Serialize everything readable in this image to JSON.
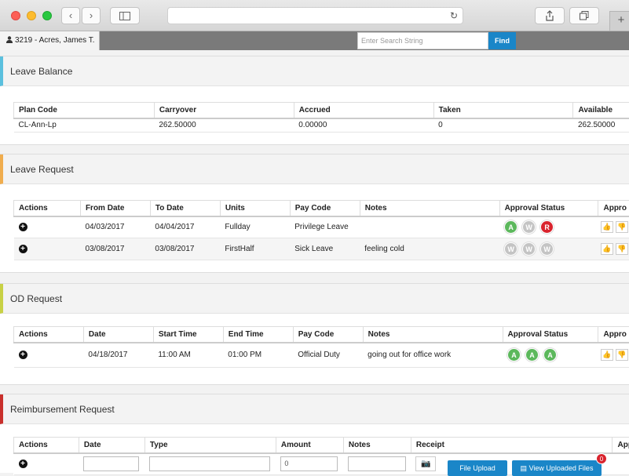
{
  "header": {
    "user_label": "3219 - Acres, James T.",
    "search_placeholder": "Enter Search String",
    "find_label": "Find"
  },
  "colors": {
    "leave_balance": "#5bc0de",
    "leave_request": "#f0ad4e",
    "od_request": "#c8d145",
    "reimbursement": "#c9302c",
    "approved": "#5cb85c",
    "rejected": "#d9232d",
    "pending": "#c4c4c4",
    "primary": "#1a86c8"
  },
  "leave_balance": {
    "title": "Leave Balance",
    "columns": [
      "Plan Code",
      "Carryover",
      "Accrued",
      "Taken",
      "Available"
    ],
    "rows": [
      [
        "CL-Ann-Lp",
        "262.50000",
        "0.00000",
        "0",
        "262.50000"
      ]
    ]
  },
  "leave_request": {
    "title": "Leave Request",
    "columns": [
      "Actions",
      "From Date",
      "To Date",
      "Units",
      "Pay Code",
      "Notes",
      "Approval Status",
      "Appro"
    ],
    "rows": [
      {
        "from": "04/03/2017",
        "to": "04/04/2017",
        "units": "Fullday",
        "pay_code": "Privilege Leave",
        "notes": "",
        "status": [
          "A",
          "W",
          "R"
        ]
      },
      {
        "from": "03/08/2017",
        "to": "03/08/2017",
        "units": "FirstHalf",
        "pay_code": "Sick Leave",
        "notes": "feeling cold",
        "status": [
          "W",
          "W",
          "W"
        ]
      }
    ]
  },
  "od_request": {
    "title": "OD Request",
    "columns": [
      "Actions",
      "Date",
      "Start Time",
      "End Time",
      "Pay Code",
      "Notes",
      "Approval Status",
      "Appro"
    ],
    "rows": [
      {
        "date": "04/18/2017",
        "start": "11:00 AM",
        "end": "01:00 PM",
        "pay_code": "Official Duty",
        "notes": "going out for office work",
        "status": [
          "A",
          "A",
          "A"
        ]
      }
    ]
  },
  "reimbursement": {
    "title": "Reimbursement Request",
    "columns": [
      "Actions",
      "Date",
      "Type",
      "Amount",
      "Notes",
      "Receipt",
      "App"
    ],
    "amount_value": "0",
    "file_upload_label": "File Upload",
    "view_files_label": "View Uploaded Files",
    "files_count": "0"
  }
}
